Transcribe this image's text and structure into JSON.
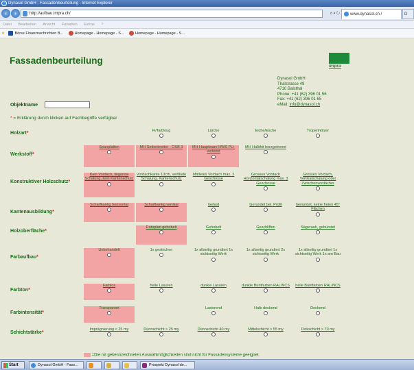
{
  "window": {
    "title": "Dynasol GmbH - Fassadenbeurteilung - Internet Explorer"
  },
  "browser": {
    "url": "http://aufbau.impra.ch/",
    "search_icon": "search-icon",
    "active_tab": "www.dynasol.ch / Fassaden",
    "tab_stub": "D",
    "menu": [
      "Datei",
      "Bearbeiten",
      "Ansicht",
      "Favoriten",
      "Extras",
      "?"
    ],
    "favorites": [
      "Börse Finanznachrichten B...",
      "Homepage - Homepage - S...",
      "Homepage - Homepage - S..."
    ]
  },
  "page": {
    "title": "Fassadenbeurteilung",
    "logo_text": "impra",
    "company": {
      "name": "Dynasol GmbH",
      "street": "Thalstrasse 49",
      "city": "4710 Balsthal",
      "phone": "Phone: +41 (62) 396 01 56",
      "fax": "Fax: +41 (62) 396 01 65",
      "email_label": "eMail:",
      "email": "info@dynasol.ch"
    },
    "objektname_label": "Objektname",
    "legend_top": "= Erklärung durch klicken auf Fachbegriffe verfügbar",
    "legend_bottom": "=Die rot gekennzeichneten Auswahlmöglichkeiten sind nicht für Fassadensysteme geeignet.",
    "highlight_color": "#f2a3a3"
  },
  "rows": [
    {
      "label": "Holzart",
      "options": [
        "",
        "Fi/Ta/Doug",
        "Lärche",
        "Eiche/Esche",
        "Tropenhölzer"
      ]
    },
    {
      "label": "Werkstoff",
      "options": [
        "Spanplatten",
        "MH Seitenbretter - OSB 3",
        "MH Hauptware HWS PU-verleimt",
        "MH Halbfrit herzgetrennt",
        ""
      ]
    },
    {
      "label": "Konstruktiver Holzschutz",
      "options": [
        "Kein Vordach, liegende Schalung, kein Kantenschutz",
        "Vordachkante 10cm, vertikale Schalung, Kantenschutz",
        "Mittleres Vordach max. 2 Geschosse",
        "Grosses Vordach Horizontalschalung max. 3 Geschosse",
        "Grosses Vordach, Vertikalschalung oder Zwischenvordächer"
      ]
    },
    {
      "label": "Kantenausbildung",
      "options": [
        "Scharfkantig horizontal",
        "Scharfkantig vertikal",
        "Gefast",
        "Gerundet bel. Profil",
        "Gerundet, keine freien 45° Flächen"
      ]
    },
    {
      "label": "Holzoberfläche",
      "options": [
        "",
        "Rotoplan gehobelt",
        "Gehobelt",
        "Geschliffen",
        "Sägerauh, gebürstet"
      ]
    },
    {
      "label": "Farbaufbau",
      "options": [
        "Unbehandelt",
        "1x gestrichen",
        "1x allseitig grundiert 1x sichtseitig Werk",
        "1x allseitig grundiert 2x sichtseitig Werk",
        "1x allseitig grundiert 1x sichtseitig Werk 1x am Bau"
      ]
    },
    {
      "label": "Farbton",
      "options": [
        "Farblos",
        "helle Lasuren",
        "dunkle Lasuren",
        "dunkle Buntfarben RAL/NCS",
        "helle Buntfarben RAL/NCS"
      ]
    },
    {
      "label": "Farbintensität",
      "options": [
        "Transparent",
        "",
        "Lasierend",
        "Halb deckend",
        "Deckend"
      ]
    },
    {
      "label": "Schichtstärke",
      "options": [
        "Imprägnierung < 25 my",
        "Dünnschicht > 25 my",
        "Dünnschicht 40 my",
        "Mittelschicht > 55 my",
        "Dickschicht > 70 my"
      ]
    }
  ],
  "taskbar": {
    "start": "Start",
    "tasks": [
      "Dynasol GmbH - Fass...",
      "",
      "",
      "Prospekt Dynasol de..."
    ]
  }
}
